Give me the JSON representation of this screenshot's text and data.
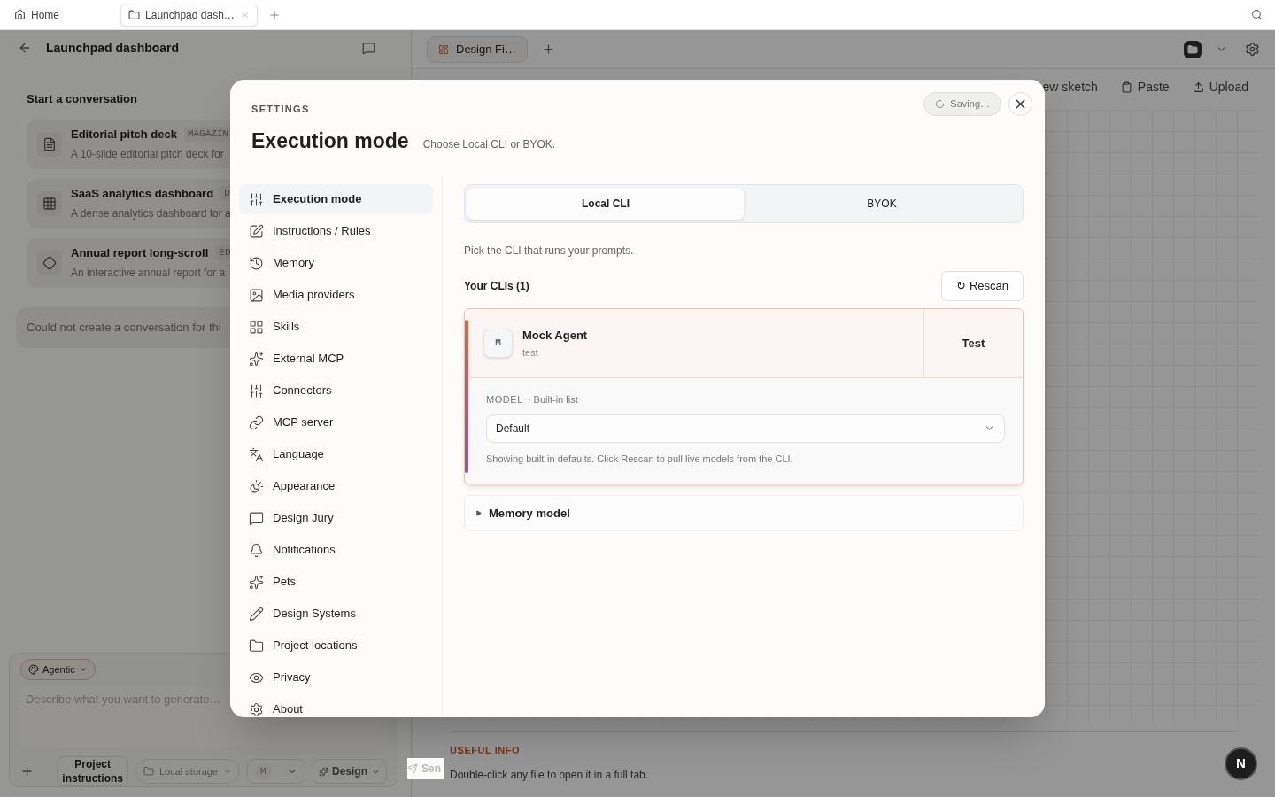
{
  "browser_tabs": [
    {
      "label": "Home",
      "selected": false,
      "kind": "home"
    },
    {
      "label": "Launchpad dash…",
      "selected": true,
      "kind": "folder"
    }
  ],
  "left_panel": {
    "title": "Launchpad dashboard",
    "section_title": "Start a conversation",
    "templates": [
      {
        "title": "Editorial pitch deck",
        "tag": "MAGAZIN",
        "description": "A 10-slide editorial pitch deck for",
        "kind": "lines"
      },
      {
        "title": "SaaS analytics dashboard",
        "tag": "D",
        "description": "A dense analytics dashboard for a",
        "kind": "grid"
      },
      {
        "title": "Annual report long-scroll",
        "tag": "ED",
        "description": "An interactive annual report for a",
        "kind": "diamond"
      }
    ],
    "error": "Could not create a conversation for thi",
    "composer": {
      "mode": "Agentic",
      "placeholder": "Describe what you want to generate…",
      "project_button": "Project instructions",
      "storage": "Local storage",
      "model": "M",
      "design": "Design",
      "send": "Sen"
    }
  },
  "workspace": {
    "tabs": [
      {
        "label": "Design Fi…",
        "selected": true
      }
    ],
    "toolbar": [
      "ew sketch",
      "Paste",
      "Upload"
    ],
    "useful_info": {
      "heading": "USEFUL INFO",
      "text": "Double-click any file to open it in a full tab."
    },
    "badge": "N"
  },
  "settings": {
    "eyebrow": "SETTINGS",
    "title": "Execution mode",
    "subtitle": "Choose Local CLI or BYOK.",
    "status": "Saving…",
    "nav": [
      {
        "label": "Execution mode",
        "selected": true
      },
      {
        "label": "Instructions / Rules",
        "selected": false
      },
      {
        "label": "Memory",
        "selected": false
      },
      {
        "label": "Media providers",
        "selected": false
      },
      {
        "label": "Skills",
        "selected": false
      },
      {
        "label": "External MCP",
        "selected": false
      },
      {
        "label": "Connectors",
        "selected": false
      },
      {
        "label": "MCP server",
        "selected": false
      },
      {
        "label": "Language",
        "selected": false
      },
      {
        "label": "Appearance",
        "selected": false
      },
      {
        "label": "Design Jury",
        "selected": false
      },
      {
        "label": "Notifications",
        "selected": false
      },
      {
        "label": "Pets",
        "selected": false
      },
      {
        "label": "Design Systems",
        "selected": false
      },
      {
        "label": "Project locations",
        "selected": false
      },
      {
        "label": "Privacy",
        "selected": false
      },
      {
        "label": "About",
        "selected": false
      }
    ],
    "mode_tabs": [
      {
        "label": "Local CLI",
        "selected": true
      },
      {
        "label": "BYOK",
        "selected": false
      }
    ],
    "hint": "Pick the CLI that runs your prompts.",
    "clis_heading": "Your CLIs (1)",
    "rescan": "↻ Rescan",
    "clis": [
      {
        "initial": "M",
        "name": "Mock Agent",
        "subtitle": "test",
        "test_button": "Test",
        "selected": true,
        "model_label": "MODEL",
        "model_source": "· Built-in list",
        "model_value": "Default",
        "model_note": "Showing built-in defaults. Click Rescan to pull live models from the CLI."
      }
    ],
    "memory_model": {
      "label": "Memory model",
      "expanded": false
    }
  }
}
